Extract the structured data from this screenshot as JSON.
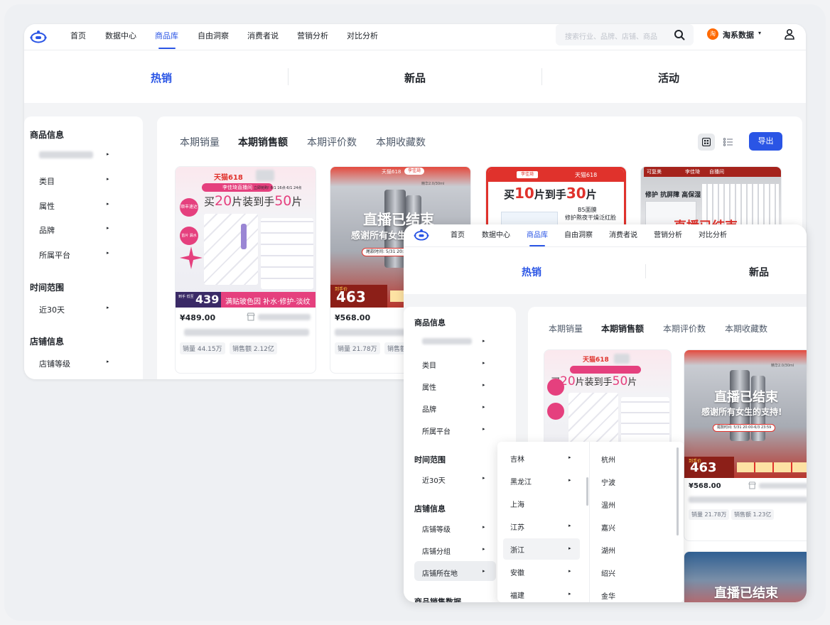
{
  "nav": {
    "items": [
      "首页",
      "数据中心",
      "商品库",
      "自由洞察",
      "消费者说",
      "营销分析",
      "对比分析"
    ],
    "active_index": 2,
    "search_placeholder": "搜索行业、品牌、店铺、商品",
    "brand_badge": "淘",
    "brand_label": "淘系数据",
    "brand_caret": "▾"
  },
  "top_tabs": [
    "热销",
    "新品",
    "活动"
  ],
  "sidebar": {
    "section_product": "商品信息",
    "items_product": [
      "类目",
      "属性",
      "品牌",
      "所属平台"
    ],
    "section_time": "时间范围",
    "time_value": "近30天",
    "section_shop": "店铺信息",
    "items_shop": [
      "店铺等级",
      "店铺分组",
      "店铺所在地"
    ],
    "section_sales": "商品销售数据",
    "arrow": "▸"
  },
  "metric_tabs": [
    "本期销量",
    "本期销售额",
    "本期评价数",
    "本期收藏数"
  ],
  "active_metric_index": 1,
  "export_label": "导出",
  "products": [
    {
      "price": "¥489.00",
      "sales_chip": "销量 44.15万",
      "revenue_chip": "销售额 2.12亿",
      "banner_brand": "天猫618",
      "banner_live": "李佳琦直播间",
      "banner_time": "立即抢购! 6/1 16点-6/1 24点",
      "banner_headline_a": "买",
      "banner_headline_b": "20",
      "banner_headline_c": "片装到手",
      "banner_headline_d": "50",
      "banner_headline_e": "片",
      "banner_badge_1": "顺丰速达",
      "banner_badge_2": "首片 漏水好物",
      "banner_deal_label": "到手 低至",
      "banner_deal_price": "439",
      "banner_bottom": "满贴玻色因 补水·修护·淡纹"
    },
    {
      "price": "¥568.00",
      "sales_chip": "销量 21.78万",
      "revenue_chip": "销售额 1.23亿",
      "banner_brand": "天猫618",
      "banner_live": "李佳琦",
      "banner_headline": "直播已结束",
      "banner_sub": "感谢所有女生的支持!",
      "banner_time": "尾款时间: 5/31 20:00-6/3 23:59",
      "banner_deal_label": "到手价",
      "banner_deal_price": "463",
      "banner_vol": "精华2.0/30ml"
    },
    {
      "banner_tag_left": "李佳琦",
      "banner_tag_right": "天猫618",
      "banner_headline_a": "买",
      "banner_headline_b": "10",
      "banner_headline_c": "片到手",
      "banner_headline_d": "30",
      "banner_headline_e": "片",
      "banner_sub_1": "B5面膜",
      "banner_sub_2": "修护熬夜干燥泛红脸"
    },
    {
      "banner_brand": "可复美",
      "banner_live": "李佳琦",
      "banner_tag": "自播间",
      "banner_sub": "修护 抗屏障 高保湿",
      "banner_ribbon": "直播已结束"
    }
  ],
  "dropdown": {
    "provinces": [
      "吉林",
      "黑龙江",
      "上海",
      "江苏",
      "浙江",
      "安徽",
      "福建"
    ],
    "province_has_children": [
      true,
      true,
      false,
      true,
      true,
      true,
      true
    ],
    "selected_province_index": 4,
    "cities": [
      "杭州",
      "宁波",
      "温州",
      "嘉兴",
      "湖州",
      "绍兴",
      "金华"
    ]
  },
  "colors": {
    "accent": "#2a55e5",
    "tmall_red": "#e0322c",
    "pink": "#e5407e",
    "brand_orange": "#ff6a00"
  }
}
